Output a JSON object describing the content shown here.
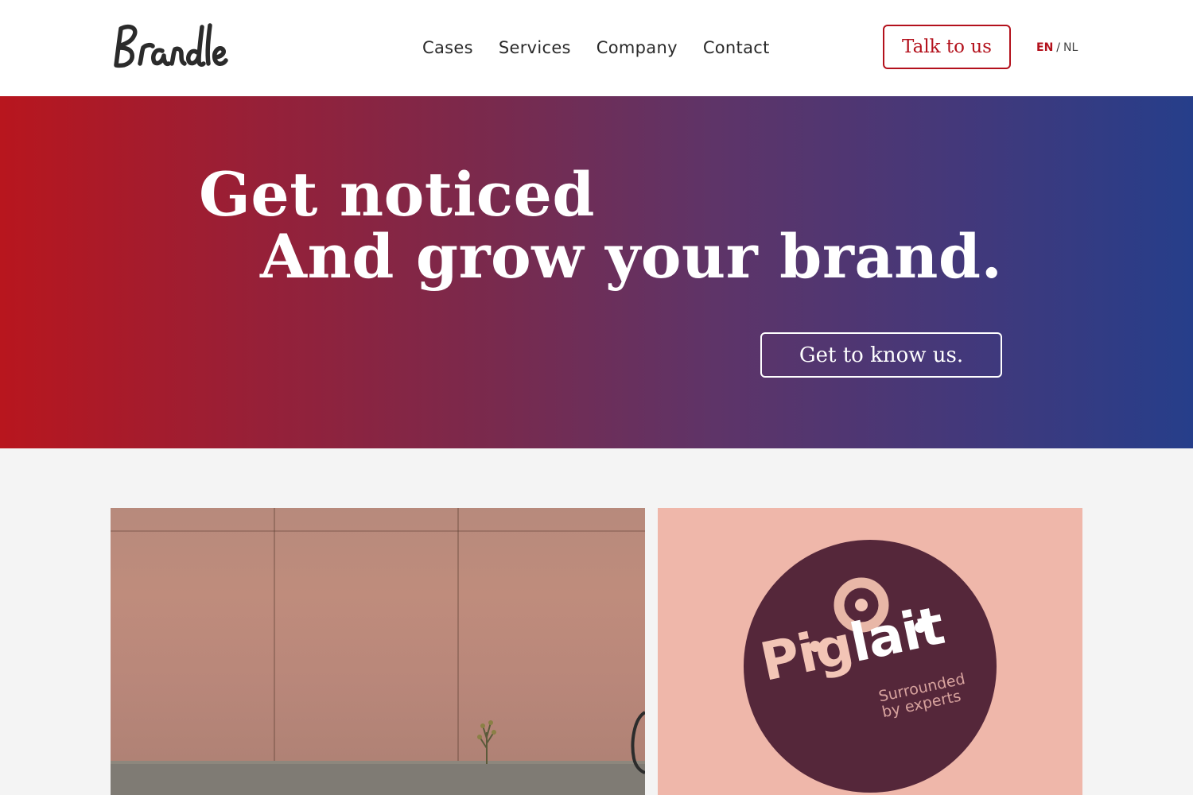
{
  "header": {
    "logo_text": "Brandle",
    "nav": [
      "Cases",
      "Services",
      "Company",
      "Contact"
    ],
    "cta_label": "Talk to us",
    "lang": {
      "active": "EN",
      "separator": "/",
      "other": "NL"
    }
  },
  "hero": {
    "line1": "Get noticed",
    "line2": "And grow your brand.",
    "button_label": "Get to know us."
  },
  "cases": {
    "right": {
      "brand_part1": "Pig",
      "brand_part2": "lait",
      "tagline": "Surrounded\nby experts"
    }
  },
  "colors": {
    "accent": "#b3111c",
    "hero_start": "#b8161e",
    "hero_end": "#263e8a",
    "badge": "#55273a",
    "badge_bg": "#efb7aa"
  }
}
